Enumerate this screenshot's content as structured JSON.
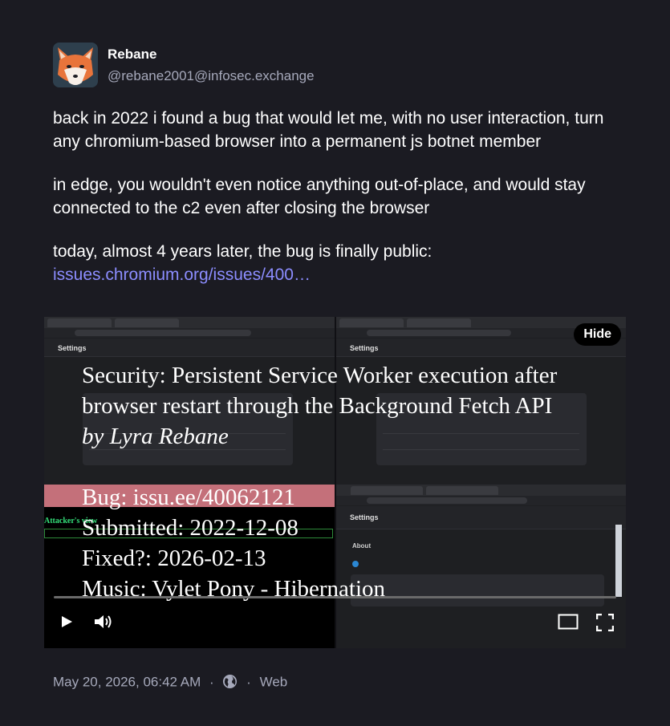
{
  "author": {
    "display_name": "Rebane",
    "handle": "@rebane2001@infosec.exchange",
    "avatar_icon": "fox-avatar-icon"
  },
  "post": {
    "paragraph1": "back in 2022 i found a bug that would let me, with no user interaction, turn any chromium-based browser into a permanent js botnet member",
    "paragraph2": "in edge, you wouldn't even notice anything out-of-place, and would stay connected to the c2 even after closing the browser",
    "paragraph3": "today, almost 4 years later, the bug is finally public:",
    "link_text": "issues.chromium.org/issues/400…"
  },
  "video": {
    "hide_label": "Hide",
    "title_line1": "Security: Persistent Service Worker execution after",
    "title_line2": "browser restart through the Background Fetch API",
    "author_line": "by Lyra Rebane",
    "bug_line": "Bug: issu.ee/40062121",
    "submitted_line": "Submitted: 2022-12-08",
    "fixed_line": "Fixed?: 2026-02-13",
    "music_line": "Music: Vylet Pony - Hibernation",
    "attacker_label": "Attacker's view",
    "pane_settings_label": "Settings",
    "pane_about_label": "About",
    "progress_fraction": 0.0,
    "icons": {
      "play": "play-icon",
      "volume": "volume-icon",
      "theater": "theater-mode-icon",
      "fullscreen": "fullscreen-icon"
    }
  },
  "meta": {
    "timestamp": "May 20, 2026, 06:42 AM",
    "separator": "·",
    "visibility_icon": "globe-icon",
    "client": "Web"
  },
  "colors": {
    "background": "#1b1b22",
    "link": "#8c8dff",
    "muted": "#a6a9bb"
  }
}
